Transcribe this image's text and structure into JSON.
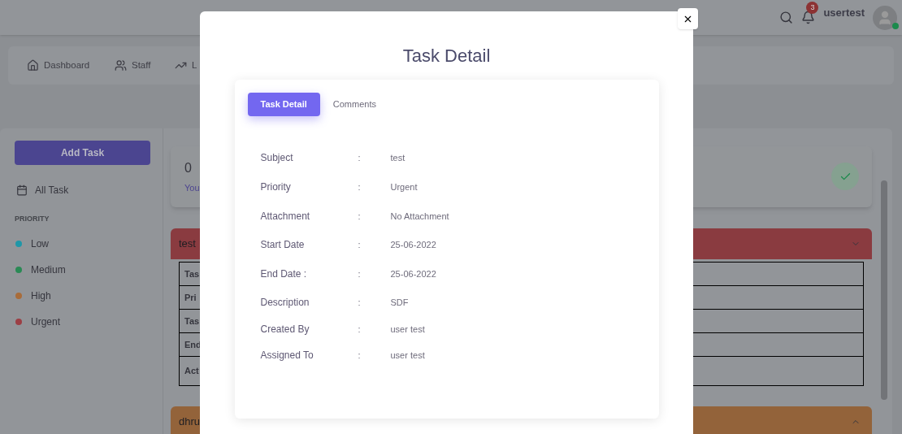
{
  "header": {
    "notifications": "3",
    "username": "usertest",
    "online": true
  },
  "nav": [
    {
      "label": "Dashboard"
    },
    {
      "label": "Staff"
    },
    {
      "label": "L"
    }
  ],
  "sidebar": {
    "add_button": "Add Task",
    "all_task": "All Task",
    "section": "PRIORITY",
    "priorities": [
      {
        "label": "Low",
        "color": "#1f97a8"
      },
      {
        "label": "Medium",
        "color": "#2a8a55"
      },
      {
        "label": "High",
        "color": "#a86c3a"
      },
      {
        "label": "Urgent",
        "color": "#9c3f45"
      }
    ]
  },
  "stats": {
    "count": "0",
    "text": "You"
  },
  "tasks": [
    {
      "title": "test",
      "color": "#8a3b40",
      "expanded": true,
      "rows": [
        "Tas",
        "Pri",
        "Tas",
        "End",
        "Act"
      ]
    },
    {
      "title": "dhru",
      "color": "#93633a",
      "expanded": false
    }
  ],
  "modal": {
    "title": "Task Detail",
    "tabs": [
      {
        "label": "Task Detail",
        "selected": true
      },
      {
        "label": "Comments",
        "selected": false
      }
    ],
    "fields": [
      {
        "label": "Subject",
        "sep": ":",
        "value": "test"
      },
      {
        "label": "Priority",
        "sep": ":",
        "value": "Urgent"
      },
      {
        "label": "Attachment",
        "sep": ":",
        "value": "No Attachment"
      },
      {
        "label": "Start Date",
        "sep": ":",
        "value": "25-06-2022"
      },
      {
        "label": "End Date :",
        "sep": ":",
        "value": "25-06-2022"
      },
      {
        "label": "Description",
        "sep": ":",
        "value": "SDF"
      },
      {
        "label": "Created By",
        "sep": ":",
        "value": "user test"
      },
      {
        "label": "Assigned To",
        "sep": ":",
        "value": "user test"
      }
    ]
  }
}
